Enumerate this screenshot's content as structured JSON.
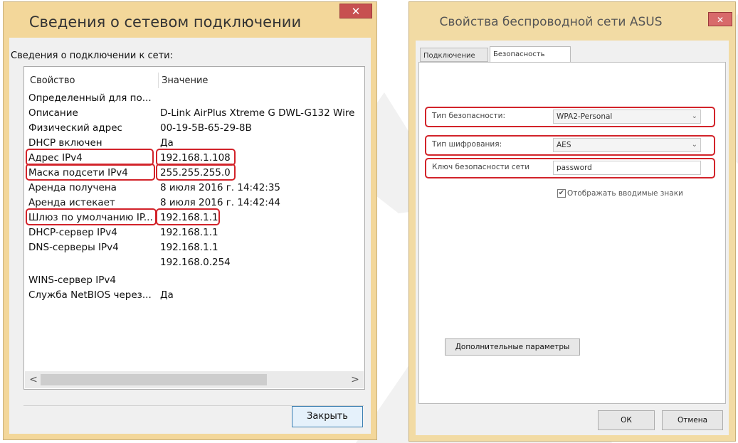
{
  "colors": {
    "highlight": "#d2232a",
    "window_frame": "#f3d79a",
    "close_button": "#c75050"
  },
  "dialog_left": {
    "title": "Сведения о сетевом подключении",
    "close_glyph": "✕",
    "heading": "Сведения о подключении к сети:",
    "columns": {
      "property": "Свойство",
      "value": "Значение"
    },
    "rows": [
      {
        "property": "Определенный для по...",
        "value": ""
      },
      {
        "property": "Описание",
        "value": "D-Link AirPlus Xtreme G DWL-G132 Wire"
      },
      {
        "property": "Физический адрес",
        "value": "00-19-5B-65-29-8B"
      },
      {
        "property": "DHCP включен",
        "value": "Да"
      },
      {
        "property": "Адрес IPv4",
        "value": "192.168.1.108"
      },
      {
        "property": "Маска подсети IPv4",
        "value": "255.255.255.0"
      },
      {
        "property": "Аренда получена",
        "value": "8 июля 2016 г. 14:42:35"
      },
      {
        "property": "Аренда истекает",
        "value": "8 июля 2016 г. 14:42:44"
      },
      {
        "property": "Шлюз по умолчанию IP...",
        "value": "192.168.1.1"
      },
      {
        "property": "DHCP-сервер IPv4",
        "value": "192.168.1.1"
      },
      {
        "property": "DNS-серверы IPv4",
        "value": "192.168.1.1"
      },
      {
        "property": "",
        "value": "192.168.0.254"
      },
      {
        "property": "WINS-сервер IPv4",
        "value": ""
      },
      {
        "property": "Служба NetBIOS через...",
        "value": "Да"
      }
    ],
    "scroll_left": "<",
    "scroll_right": ">",
    "close_button": "Закрыть"
  },
  "dialog_right": {
    "title": "Свойства беспроводной сети ASUS",
    "close_glyph": "✕",
    "tabs": [
      "Подключение",
      "Безопасность"
    ],
    "security_type_label": "Тип безопасности:",
    "security_type_value": "WPA2-Personal",
    "encryption_type_label": "Тип шифрования:",
    "encryption_type_value": "AES",
    "key_label": "Ключ безопасности сети",
    "key_value": "password",
    "show_chars_label": "Отображать вводимые знаки",
    "show_chars_checked": true,
    "advanced_button": "Дополнительные параметры",
    "ok_button": "ОК",
    "cancel_button": "Отмена"
  }
}
